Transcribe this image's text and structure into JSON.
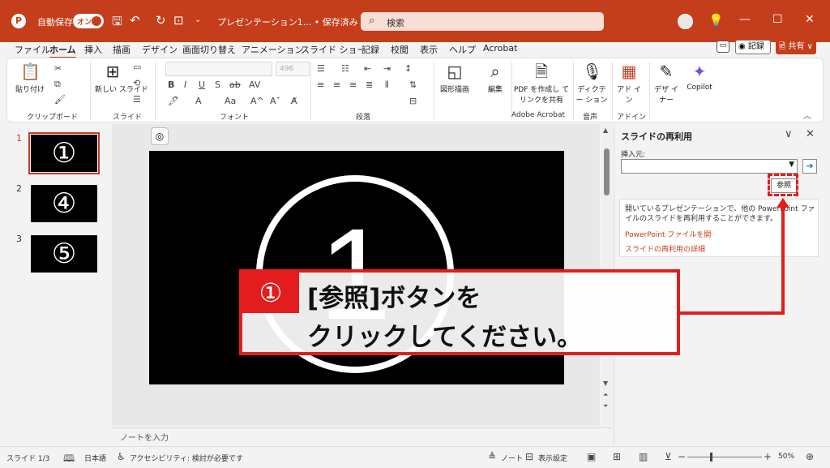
{
  "titlebar": {
    "autosave_label": "自動保存",
    "autosave_state": "オン",
    "doc_title": "プレゼンテーション1... • 保存済み ∨",
    "search_placeholder": "検索"
  },
  "menu": {
    "tabs": [
      "ファイル",
      "ホーム",
      "挿入",
      "描画",
      "デザイン",
      "画面切り替え",
      "アニメーション",
      "スライド ショー",
      "記録",
      "校閲",
      "表示",
      "ヘルプ",
      "Acrobat"
    ],
    "active_tab": "ホーム",
    "record_label": "◉ 記録",
    "share_label": "🖻 共有 ∨"
  },
  "ribbon": {
    "paste_label": "貼り付け",
    "new_slide_label": "新しい スライド",
    "shapes_label": "図形描画",
    "edit_label": "編集",
    "pdf_label": "PDF を作成し てリンクを共有",
    "dictate_label": "ディクテー ション",
    "addin_label": "アド イン",
    "designer_label": "デザ イナー",
    "copilot_label": "Copilot",
    "font_size": "496",
    "groups": {
      "clipboard": "クリップボード",
      "slides": "スライド",
      "font": "フォント",
      "paragraph": "段落",
      "acrobat": "Adobe Acrobat",
      "voice": "音声",
      "addins": "アドイン"
    }
  },
  "thumbnails": [
    {
      "num": "1",
      "glyph": "①"
    },
    {
      "num": "2",
      "glyph": "④"
    },
    {
      "num": "3",
      "glyph": "⑤"
    }
  ],
  "slide": {
    "number": "1"
  },
  "notes_placeholder": "ノートを入力",
  "reuse_pane": {
    "title": "スライドの再利用",
    "insert_from_label": "挿入元:",
    "browse_label": "参照",
    "description": "開いているプレゼンテーションで、他の PowerPoint ファイルのスライドを再利用することができます。",
    "link_open": "PowerPoint ファイルを開",
    "link_details": "スライドの再利用の詳細"
  },
  "callout": {
    "badge": "①",
    "line1": "[参照]ボタンを",
    "line2": "クリックしてください。"
  },
  "status": {
    "slide_count": "スライド 1/3",
    "language": "日本語",
    "accessibility": "アクセシビリティ: 検討が必要です",
    "notes_label": "ノート",
    "display_settings": "表示設定",
    "zoom": "50%"
  },
  "colors": {
    "accent": "#c43e1c",
    "annotation": "#e31d1d"
  }
}
